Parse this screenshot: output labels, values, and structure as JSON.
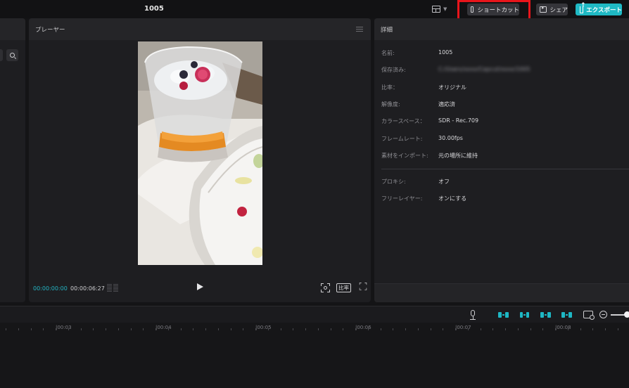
{
  "app": {
    "title": "1005"
  },
  "topbar": {
    "shortcut_label": "ショートカット",
    "share_label": "シェア",
    "export_label": "エクスポート"
  },
  "player": {
    "title": "プレーヤー",
    "current_time": "00:00:00:00",
    "total_time": "00:00:06:27",
    "ratio_label": "比率"
  },
  "details": {
    "title": "詳細",
    "rows": [
      {
        "label": "名前:",
        "value": "1005"
      },
      {
        "label": "保存済み:",
        "value": "C:/Users/xxxx/Capcut/xxxx/1005"
      },
      {
        "label": "比率：",
        "value": "オリジナル"
      },
      {
        "label": "解像度:",
        "value": "適応済"
      },
      {
        "label": "カラースペース：",
        "value": "SDR - Rec.709"
      },
      {
        "label": "フレームレート:",
        "value": "30.00fps"
      },
      {
        "label": "素材をインポート:",
        "value": "元の場所に維持"
      },
      {
        "label": "プロキシ:",
        "value": "オフ"
      },
      {
        "label": "フリーレイヤー:",
        "value": "オンにする"
      }
    ]
  },
  "timeline": {
    "ruler_labels": [
      "|00:03",
      "|00:04",
      "|00:05",
      "|00:06",
      "|00:07",
      "|00:08"
    ]
  },
  "colors": {
    "accent": "#1fb9c4",
    "highlight": "#e8151b",
    "panel": "#1e1e21",
    "background": "#141416"
  },
  "icons": [
    "layout-icon",
    "keyboard-icon",
    "share-icon",
    "export-icon",
    "search-icon",
    "menu-icon",
    "scopes-icon",
    "play-icon",
    "fit-view-icon",
    "fullscreen-icon",
    "microphone-icon",
    "snap-icon",
    "magnet-icon",
    "link-icon",
    "preview-axis-icon",
    "zoom-out-icon"
  ]
}
